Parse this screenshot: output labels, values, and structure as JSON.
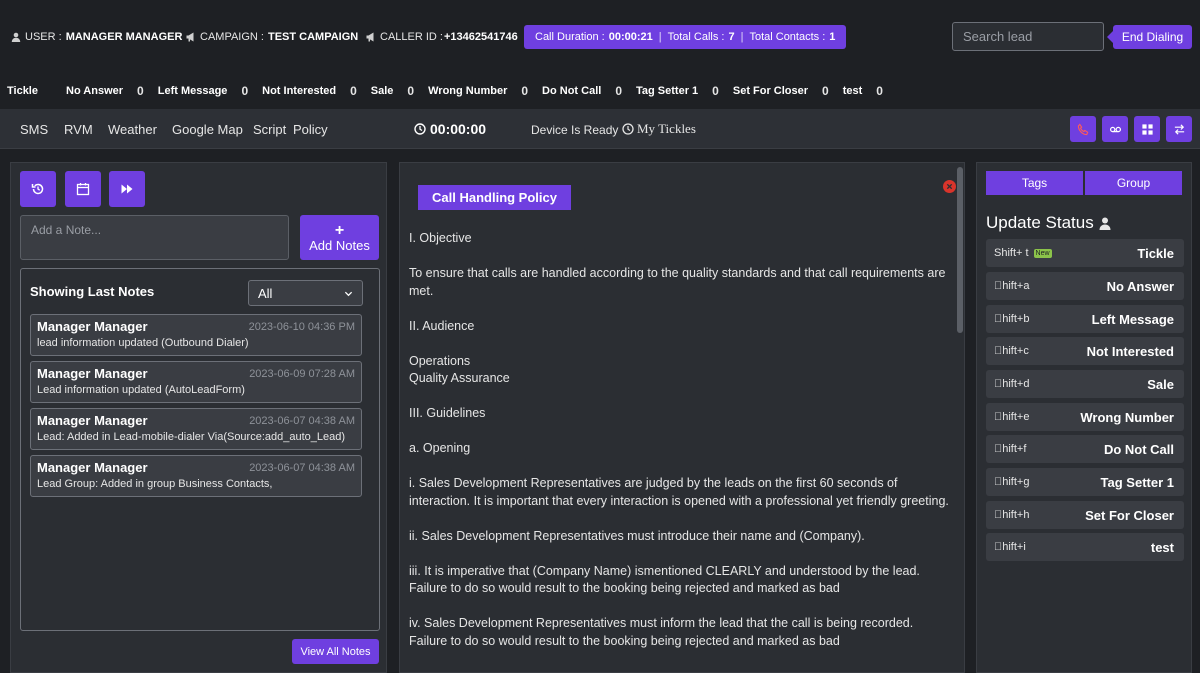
{
  "header": {
    "user_label": "USER :",
    "user_value": "MANAGER MANAGER",
    "campaign_label": "CAMPAIGN :",
    "campaign_value": "TEST CAMPAIGN",
    "caller_label": "CALLER ID :",
    "caller_value": "+13462541746",
    "call_duration_label": "Call Duration :",
    "call_duration_value": "00:00:21",
    "total_calls_label": "Total Calls :",
    "total_calls_value": "7",
    "total_contacts_label": "Total Contacts :",
    "total_contacts_value": "1",
    "search_placeholder": "Search lead",
    "end_dialing_label": "End Dialing"
  },
  "counts": [
    {
      "label": "Tickle",
      "value": ""
    },
    {
      "label": "No Answer",
      "value": "0"
    },
    {
      "label": "Left Message",
      "value": "0"
    },
    {
      "label": "Not Interested",
      "value": "0"
    },
    {
      "label": "Sale",
      "value": "0"
    },
    {
      "label": "Wrong Number",
      "value": "0"
    },
    {
      "label": "Do Not Call",
      "value": "0"
    },
    {
      "label": "Tag Setter 1",
      "value": "0"
    },
    {
      "label": "Set For Closer",
      "value": "0"
    },
    {
      "label": "test",
      "value": "0"
    }
  ],
  "nav": {
    "sms": "SMS",
    "rvm": "RVM",
    "weather": "Weather",
    "google_map": "Google Map",
    "script": "Script",
    "policy": "Policy",
    "timer": "00:00:00",
    "device_status": "Device Is Ready",
    "my_tickles": "My Tickles"
  },
  "notes": {
    "input_placeholder": "Add a Note...",
    "add_plus": "+",
    "add_label": "Add Notes",
    "section_title": "Showing Last Notes",
    "filter_value": "All",
    "items": [
      {
        "author": "Manager Manager",
        "date": "2023-06-10 04:36 PM",
        "message": "lead information updated (Outbound Dialer)"
      },
      {
        "author": "Manager Manager",
        "date": "2023-06-09 07:28 AM",
        "message": "Lead information updated (AutoLeadForm)"
      },
      {
        "author": "Manager Manager",
        "date": "2023-06-07 04:38 AM",
        "message": "Lead: Added in Lead-mobile-dialer Via(Source:add_auto_Lead)"
      },
      {
        "author": "Manager Manager",
        "date": "2023-06-07 04:38 AM",
        "message": "Lead Group: Added in group Business Contacts,"
      }
    ],
    "view_all_label": "View All Notes"
  },
  "policy": {
    "tab_label": "Call Handling Policy",
    "paragraphs": [
      "I. Objective",
      "To ensure that calls are handled according to the quality standards and that call requirements are met.",
      "II. Audience",
      "Operations\nQuality Assurance",
      "III. Guidelines",
      "a. Opening",
      "i. Sales Development Representatives are judged by the leads on the first 60 seconds of interaction. It is important that every interaction is opened with a professional yet friendly greeting.",
      "ii. Sales Development Representatives must introduce their name and (Company).",
      "iii. It is imperative that (Company Name) ismentioned CLEARLY and understood by the lead. Failure to do so would result to the booking being rejected and marked as bad",
      "iv. Sales Development Representatives must inform the lead that the call is being recorded. Failure to do so would result to the booking being rejected and marked as bad"
    ]
  },
  "status_panel": {
    "tags_label": "Tags",
    "group_label": "Group",
    "title": "Update Status",
    "new_badge": "New",
    "items": [
      {
        "shortcut": "Shift+ t",
        "label": "Tickle",
        "is_new": true
      },
      {
        "shortcut": "\u0000hift+a",
        "label": "No Answer"
      },
      {
        "shortcut": "\u0000hift+b",
        "label": "Left Message"
      },
      {
        "shortcut": "\u0000hift+c",
        "label": "Not Interested"
      },
      {
        "shortcut": "\u0000hift+d",
        "label": "Sale"
      },
      {
        "shortcut": "\u0000hift+e",
        "label": "Wrong Number"
      },
      {
        "shortcut": "\u0000hift+f",
        "label": "Do Not Call"
      },
      {
        "shortcut": "\u0000hift+g",
        "label": "Tag Setter 1"
      },
      {
        "shortcut": "\u0000hift+h",
        "label": "Set For Closer"
      },
      {
        "shortcut": "\u0000hift+i",
        "label": "test"
      }
    ]
  },
  "colors": {
    "accent": "#6f3fe0",
    "background": "#1e2024",
    "panel": "#2b2e33",
    "danger": "#d9342b"
  }
}
